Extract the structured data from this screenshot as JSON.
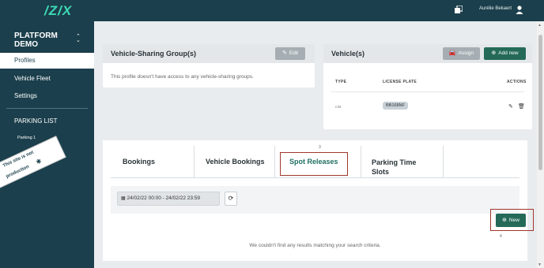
{
  "header": {
    "logo": "/Z/X",
    "user_name": "Aurélie Bekaert",
    "icons": [
      "windows-icon",
      "user-icon"
    ]
  },
  "sidebar": {
    "platform": "PLATFORM\nDEMO",
    "chevron": "⌃\n⌄",
    "items": [
      {
        "label": "Profiles",
        "active": true
      },
      {
        "label": "Vehicle Fleet"
      },
      {
        "label": "Settings"
      }
    ],
    "parking_title": "PARKING LIST",
    "parking_item": "Parking 1",
    "ribbon": [
      "This site is not",
      "production"
    ]
  },
  "vsg_card": {
    "title": "Vehicle-Sharing Group(s)",
    "edit_label": "Edit",
    "empty_text": "This profile doesn't have access to any vehicle-sharing groups."
  },
  "vehicles_card": {
    "title": "Vehicle(s)",
    "assign_label": "Assign",
    "add_label": "Add new",
    "columns": [
      "TYPE",
      "LICENSE PLATE",
      "ACTIONS"
    ],
    "rows": [
      {
        "type": "car",
        "plate": "BB168NF"
      }
    ]
  },
  "tabs": {
    "items": [
      "Bookings",
      "Vehicle Bookings",
      "Spot Releases",
      "Parking Time Slots"
    ],
    "active": "Spot Releases",
    "annotation_tab": "3",
    "annotation_new": "4"
  },
  "filter": {
    "date_range": "24/02/22 00:00 - 24/02/22 23:59"
  },
  "new_button": "New",
  "empty_results": "We couldn't find any results matching your search criteria.",
  "colors": {
    "sidebar_bg": "#1b3f4c",
    "accent": "#3dd9b5",
    "primary_button": "#256a58",
    "highlight_box": "#a0362b"
  }
}
